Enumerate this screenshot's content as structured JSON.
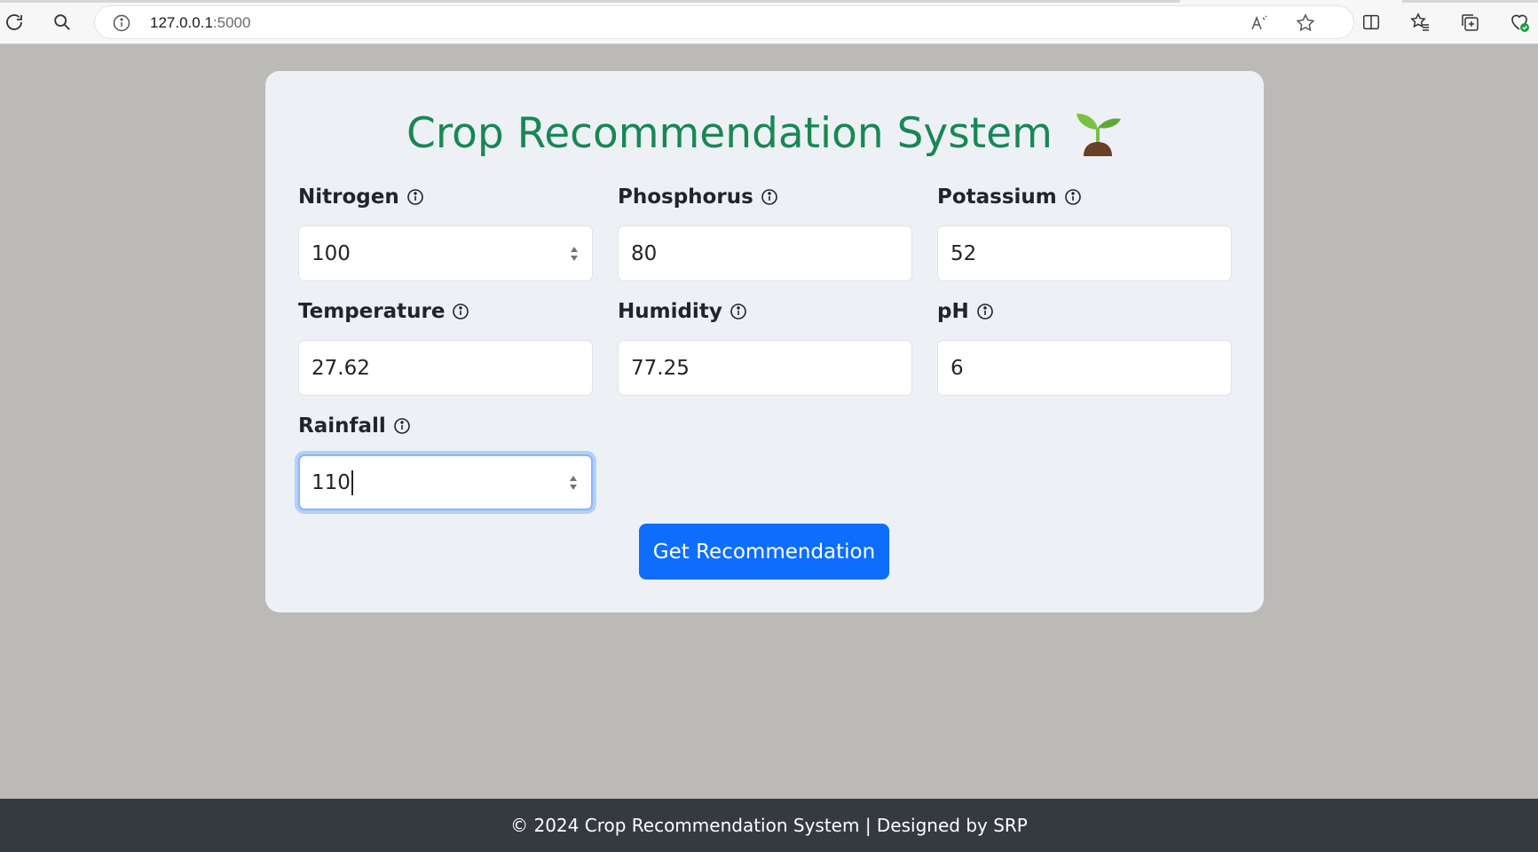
{
  "browser": {
    "url_host": "127.0.0.1",
    "url_port": ":5000"
  },
  "page": {
    "title": "Crop Recommendation System",
    "title_emoji_icon": "seedling-icon",
    "accent_color": "#198754",
    "button_color": "#0d6efd"
  },
  "form": {
    "fields": [
      {
        "label": "Nitrogen",
        "value": "100",
        "spinner": true
      },
      {
        "label": "Phosphorus",
        "value": "80",
        "spinner": false
      },
      {
        "label": "Potassium",
        "value": "52",
        "spinner": false
      },
      {
        "label": "Temperature",
        "value": "27.62",
        "spinner": false
      },
      {
        "label": "Humidity",
        "value": "77.25",
        "spinner": false
      },
      {
        "label": "pH",
        "value": "6",
        "spinner": false
      },
      {
        "label": "Rainfall",
        "value": "110",
        "spinner": true,
        "focused": true
      }
    ],
    "submit_label": "Get Recommendation"
  },
  "footer": {
    "text": "© 2024 Crop Recommendation System | Designed by SRP"
  }
}
